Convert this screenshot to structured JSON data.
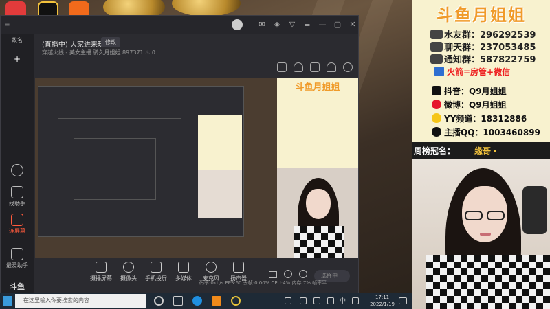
{
  "window": {
    "stream_title": "(直播中) 大家进来玩",
    "edit_label": "修改",
    "meta": "穿越火线 - 美女主播    骑久月姐姐   897371   ♨ 0",
    "sidebar": [
      {
        "label": "故名"
      },
      {
        "label": "找助手"
      },
      {
        "label": "连屏幕"
      },
      {
        "label": "最爱助手"
      },
      {
        "label": "斗鱼"
      }
    ],
    "bottom_bar": [
      {
        "label": "摄播屏幕"
      },
      {
        "label": "摄像头"
      },
      {
        "label": "手机投屏"
      },
      {
        "label": "多媒体"
      },
      {
        "label": "麦克风"
      },
      {
        "label": "扬声器"
      }
    ],
    "select_label": "选择中...",
    "status": "码率:0kb/s    FPS:60    丢帧:0.00%    CPU:4%    内存:7%    帧率平"
  },
  "taskbar": {
    "search_placeholder": "在这里输入你要搜索的内容",
    "ime": "中",
    "time": "17:11",
    "date": "2022/1/19"
  },
  "panel": {
    "logo": "斗鱼月姐姐",
    "groups": [
      {
        "label": "水友群：",
        "value": "296292539"
      },
      {
        "label": "聊天群：",
        "value": "237053485"
      },
      {
        "label": "通知群：",
        "value": "587822759"
      }
    ],
    "highlight": "火箭=房管+微信",
    "socials": [
      {
        "label": "抖音：",
        "value": "Q9月姐姐",
        "color": "#111111"
      },
      {
        "label": "微博：",
        "value": "Q9月姐姐",
        "color": "#e6162d"
      },
      {
        "label": "YY频道：",
        "value": "18312886",
        "color": "#f5c518"
      },
      {
        "label": "主播QQ：",
        "value": "1003460899",
        "color": "#111111"
      }
    ],
    "crown_label": "周榜冠名：",
    "crown_name": "缘哥・"
  }
}
